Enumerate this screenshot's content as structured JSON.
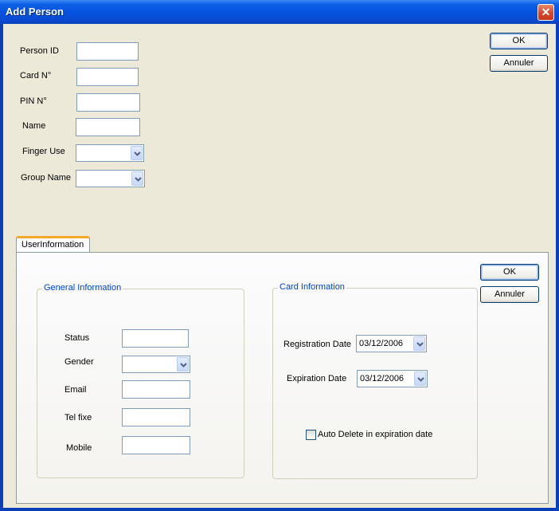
{
  "window": {
    "title": "Add Person",
    "close_glyph": "✕"
  },
  "top_form": {
    "person_id_label": "Person ID",
    "card_no_label": "Card N°",
    "pin_no_label": "PIN N°",
    "name_label": "Name",
    "finger_use_label": "Finger Use",
    "group_name_label": "Group Name",
    "person_id_value": "",
    "card_no_value": "",
    "pin_no_value": "",
    "name_value": "",
    "finger_use_value": "",
    "group_name_value": ""
  },
  "top_buttons": {
    "ok": "OK",
    "cancel": "Annuler"
  },
  "tabs": [
    {
      "label": "UserInformation",
      "selected": true
    }
  ],
  "panel_buttons": {
    "ok": "OK",
    "cancel": "Annuler"
  },
  "general_info": {
    "legend": "General Information",
    "status_label": "Status",
    "gender_label": "Gender",
    "email_label": "Email",
    "tel_label": "Tel fixe",
    "mobile_label": "Mobile",
    "status_value": "",
    "gender_value": "",
    "email_value": "",
    "tel_value": "",
    "mobile_value": ""
  },
  "card_info": {
    "legend": "Card Information",
    "registration_label": "Registration Date",
    "registration_value": "03/12/2006",
    "expiration_label": "Expiration Date",
    "expiration_value": "03/12/2006",
    "auto_delete_label": "Auto Delete in expiration date",
    "auto_delete_checked": false
  },
  "icons": {
    "dropdown": "chevron-down-icon",
    "close": "close-icon"
  },
  "colors": {
    "titlebar": "#0553e0",
    "client_bg": "#ece9d8",
    "legend_text": "#0046d5",
    "tab_accent": "#f5a92a"
  }
}
